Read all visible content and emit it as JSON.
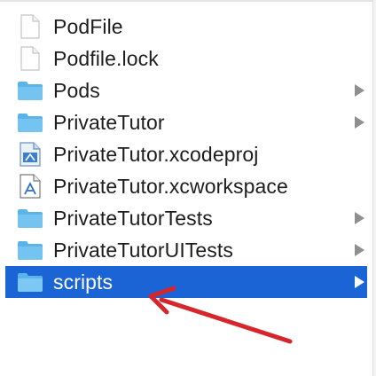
{
  "colors": {
    "selection": "#1a64d6",
    "folder": "#5ab4ea",
    "arrow": "#d6262b"
  },
  "files": [
    {
      "name": "PodFile",
      "icon": "document-icon",
      "has_children": false,
      "selected": false
    },
    {
      "name": "Podfile.lock",
      "icon": "document-icon",
      "has_children": false,
      "selected": false
    },
    {
      "name": "Pods",
      "icon": "folder-icon",
      "has_children": true,
      "selected": false
    },
    {
      "name": "PrivateTutor",
      "icon": "folder-icon",
      "has_children": true,
      "selected": false
    },
    {
      "name": "PrivateTutor.xcodeproj",
      "icon": "xcodeproj-icon",
      "has_children": false,
      "selected": false
    },
    {
      "name": "PrivateTutor.xcworkspace",
      "icon": "xcworkspace-icon",
      "has_children": false,
      "selected": false
    },
    {
      "name": "PrivateTutorTests",
      "icon": "folder-icon",
      "has_children": true,
      "selected": false
    },
    {
      "name": "PrivateTutorUITests",
      "icon": "folder-icon",
      "has_children": true,
      "selected": false
    },
    {
      "name": "scripts",
      "icon": "folder-icon",
      "has_children": true,
      "selected": true
    }
  ],
  "annotation": {
    "icon": "red-arrow-icon"
  }
}
